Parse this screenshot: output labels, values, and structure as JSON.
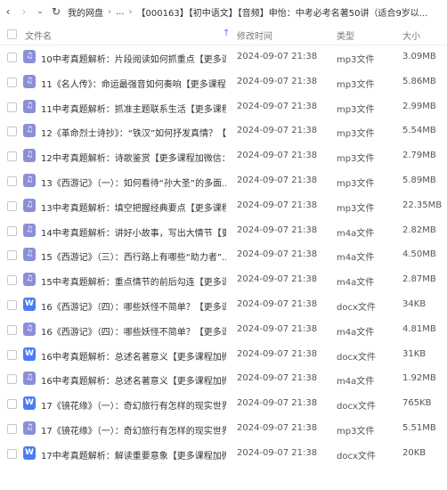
{
  "toolbar": {
    "back_icon": "chevron-left-icon",
    "forward_icon": "chevron-right-icon",
    "dropdown_icon": "chevron-down-icon",
    "refresh_icon": "refresh-icon",
    "breadcrumb": [
      "我的网盘",
      "...",
      "【000163】【初中语文】【音频】申怡：中考必考名著50讲（适合9岁以..."
    ]
  },
  "columns": {
    "name": "文件名",
    "modified": "修改时间",
    "type": "类型",
    "size": "大小"
  },
  "colors": {
    "audio_icon": "#8b8fd9",
    "doc_icon": "#4a7cf3"
  },
  "files": [
    {
      "name": "10中考真题解析：片段阅读如何抓重点【更多课程...",
      "modified": "2024-09-07 21:38",
      "type": "mp3文件",
      "size": "3.09MB",
      "kind": "audio"
    },
    {
      "name": "11《名人传》：命运最强音如何奏响【更多课程加...",
      "modified": "2024-09-07 21:38",
      "type": "mp3文件",
      "size": "5.86MB",
      "kind": "audio"
    },
    {
      "name": "11中考真题解析：抓准主题联系生活【更多课程加...",
      "modified": "2024-09-07 21:38",
      "type": "mp3文件",
      "size": "2.99MB",
      "kind": "audio"
    },
    {
      "name": "12《革命烈士诗抄》：“铁汉”如何抒发真情？【...",
      "modified": "2024-09-07 21:38",
      "type": "mp3文件",
      "size": "5.54MB",
      "kind": "audio"
    },
    {
      "name": "12中考真题解析：诗歌鉴赏【更多课程加微信：58...",
      "modified": "2024-09-07 21:38",
      "type": "mp3文件",
      "size": "2.79MB",
      "kind": "audio"
    },
    {
      "name": "13《西游记》（一）：如何看待“孙大圣”的多面...",
      "modified": "2024-09-07 21:38",
      "type": "mp3文件",
      "size": "5.89MB",
      "kind": "audio"
    },
    {
      "name": "13中考真题解析：填空把握经典要点【更多课程加...",
      "modified": "2024-09-07 21:38",
      "type": "mp3文件",
      "size": "22.35MB",
      "kind": "audio"
    },
    {
      "name": "14中考真题解析：讲好小故事，写出大情节【更多...",
      "modified": "2024-09-07 21:38",
      "type": "m4a文件",
      "size": "2.82MB",
      "kind": "audio"
    },
    {
      "name": "15《西游记》（三）：西行路上有哪些“助力者”...",
      "modified": "2024-09-07 21:38",
      "type": "m4a文件",
      "size": "4.50MB",
      "kind": "audio"
    },
    {
      "name": "15中考真题解析：重点情节的前后勾连【更多课程...",
      "modified": "2024-09-07 21:38",
      "type": "m4a文件",
      "size": "2.87MB",
      "kind": "audio"
    },
    {
      "name": "16《西游记》（四）：哪些妖怪不简单？【更多课...",
      "modified": "2024-09-07 21:38",
      "type": "docx文件",
      "size": "34KB",
      "kind": "doc"
    },
    {
      "name": "16《西游记》（四）：哪些妖怪不简单？【更多课...",
      "modified": "2024-09-07 21:38",
      "type": "m4a文件",
      "size": "4.81MB",
      "kind": "audio"
    },
    {
      "name": "16中考真题解析：总述名著意义【更多课程加微信...",
      "modified": "2024-09-07 21:38",
      "type": "docx文件",
      "size": "31KB",
      "kind": "doc"
    },
    {
      "name": "16中考真题解析：总述名著意义【更多课程加微信...",
      "modified": "2024-09-07 21:38",
      "type": "m4a文件",
      "size": "1.92MB",
      "kind": "audio"
    },
    {
      "name": "17《镜花缘》（一）：奇幻旅行有怎样的现实世界...",
      "modified": "2024-09-07 21:38",
      "type": "docx文件",
      "size": "765KB",
      "kind": "doc"
    },
    {
      "name": "17《镜花缘》（一）：奇幻旅行有怎样的现实世界...",
      "modified": "2024-09-07 21:38",
      "type": "mp3文件",
      "size": "5.51MB",
      "kind": "audio"
    },
    {
      "name": "17中考真题解析：解读重要意象【更多课程加微信...",
      "modified": "2024-09-07 21:38",
      "type": "docx文件",
      "size": "20KB",
      "kind": "doc"
    }
  ]
}
